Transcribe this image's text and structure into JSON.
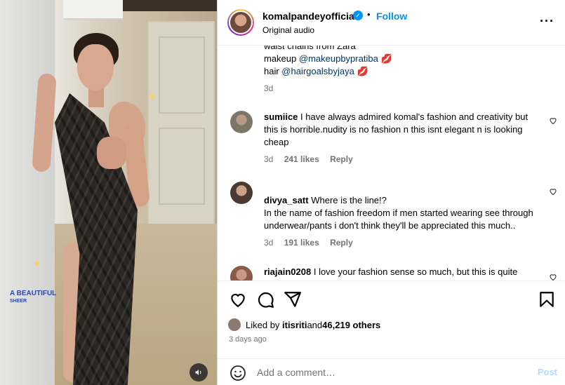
{
  "media": {
    "overlay_title": "A BEAUTIFUL",
    "overlay_subtitle": "SHEER"
  },
  "header": {
    "username": "komalpandeyofficial",
    "follow_label": "Follow",
    "audio_label": "Original audio"
  },
  "caption": {
    "line_partial": "waist chains from Zara",
    "makeup_prefix": "makeup ",
    "makeup_handle": "@makeupbypratiba",
    "hair_prefix": "hair ",
    "hair_handle": "@hairgoalsbyjaya",
    "lips_emoji": "💋",
    "time": "3d"
  },
  "comments": [
    {
      "user": "sumiice",
      "text": "I have always admired komal's fashion and creativity but this is horrible.nudity is no fashion n this isnt elegant n is looking cheap",
      "time": "3d",
      "likes": "241 likes",
      "reply": "Reply"
    },
    {
      "user": "divya_satt",
      "text": "Where is the line!?\nIn the name of fashion freedom if men started wearing see through underwear/pants i don't think they'll be appreciated this much..",
      "time": "3d",
      "likes": "191 likes",
      "reply": "Reply"
    },
    {
      "user": "riajain0208",
      "text": "I love your fashion sense so much, but this is quite",
      "time": "",
      "likes": "",
      "reply": ""
    }
  ],
  "likes_bar": {
    "prefix": "Liked by ",
    "user": "itisriti",
    "middle": " and ",
    "count": "46,219 others"
  },
  "posted": "3 days ago",
  "add_comment": {
    "placeholder": "Add a comment…",
    "post_label": "Post"
  },
  "icons": [
    "heart-icon",
    "comment-icon",
    "share-icon",
    "bookmark-icon",
    "emoji-icon",
    "volume-icon",
    "more-icon",
    "verified-icon",
    "sparkle-icon"
  ],
  "colors": {
    "accent": "#0095f6",
    "mention": "#00376b",
    "muted": "#737373",
    "post_disabled": "#b3dbff"
  }
}
